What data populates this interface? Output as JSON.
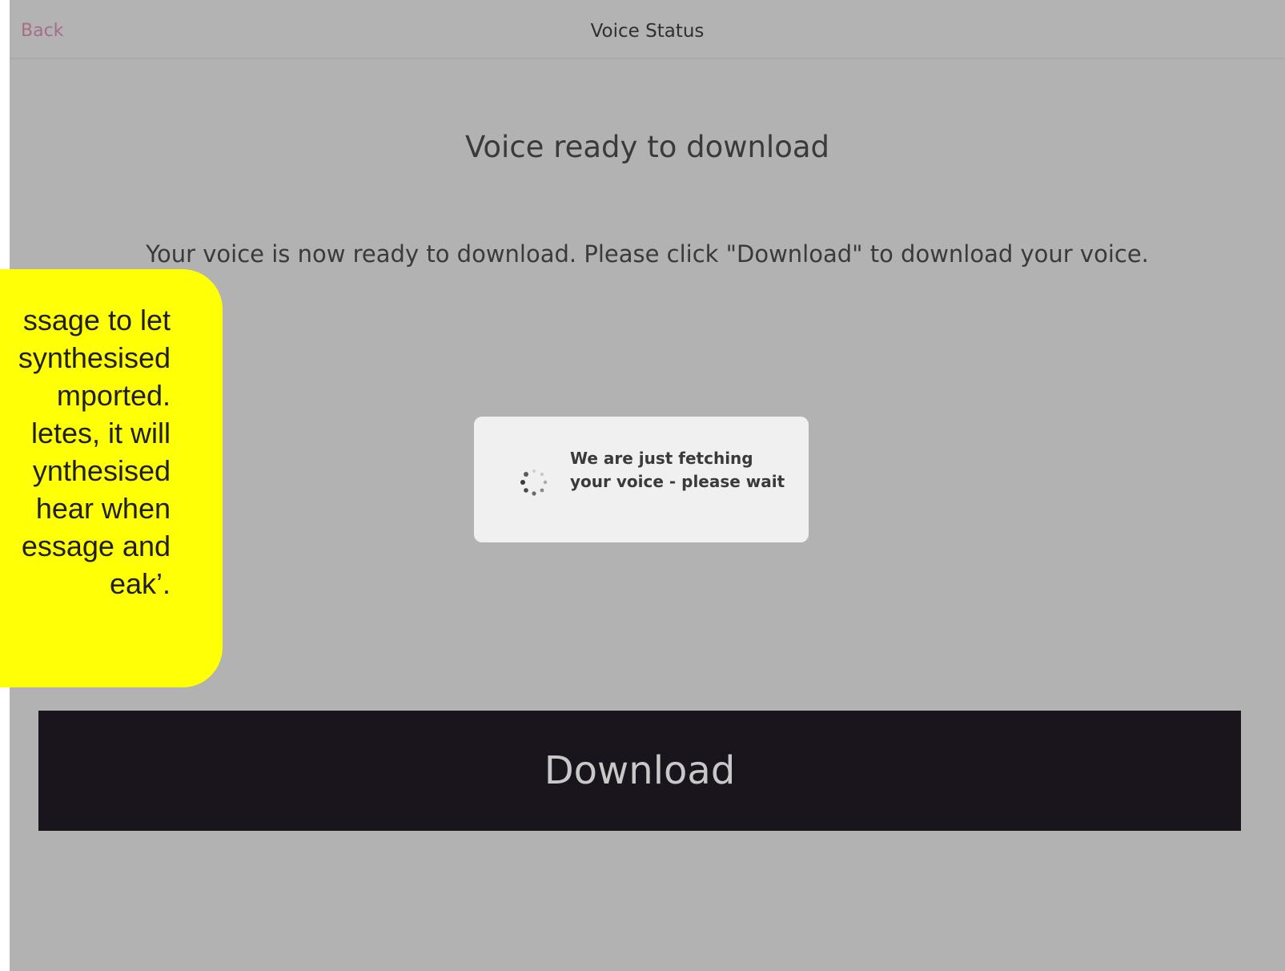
{
  "navbar": {
    "back_label": "Back",
    "title": "Voice Status"
  },
  "main": {
    "heading": "Voice ready to download",
    "description": "Your voice is now ready to download. Please click \"Download\" to download your voice."
  },
  "loading_dialog": {
    "message": "We are just fetching your voice - please wait",
    "icon": "spinner-icon"
  },
  "download_button": {
    "label": "Download"
  },
  "callout": {
    "lines": [
      "ssage to let",
      "synthesised",
      "mported.",
      "letes, it will",
      "ynthesised",
      "hear when",
      "essage and",
      "eak’."
    ]
  },
  "colors": {
    "screen_background": "#b2b2b2",
    "back_link": "#a86d86",
    "button_background": "#1a151d",
    "callout_background": "#ffff05",
    "dialog_background": "#f0f0f0"
  }
}
